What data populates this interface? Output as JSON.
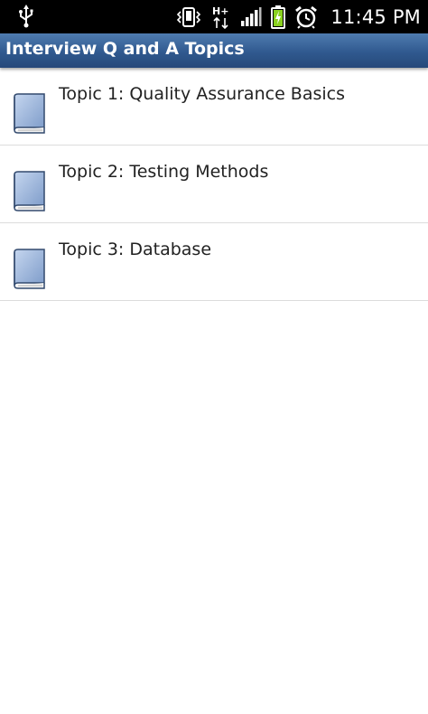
{
  "status_bar": {
    "time": "11:45 PM",
    "network_type": "H+",
    "icons": [
      "usb-icon",
      "vibrate-icon",
      "network-hplus-icon",
      "signal-icon",
      "battery-charging-icon",
      "alarm-icon"
    ]
  },
  "app_bar": {
    "title": "Interview Q and A Topics"
  },
  "topics": [
    {
      "label": "Topic 1: Quality Assurance Basics",
      "icon": "book-icon"
    },
    {
      "label": "Topic 2: Testing Methods",
      "icon": "book-icon"
    },
    {
      "label": "Topic 3: Database",
      "icon": "book-icon"
    }
  ],
  "colors": {
    "title_bar": "#30598f",
    "status_bar": "#000000",
    "book_cover": "#9fb8dd",
    "battery_charge": "#8ad11f"
  }
}
